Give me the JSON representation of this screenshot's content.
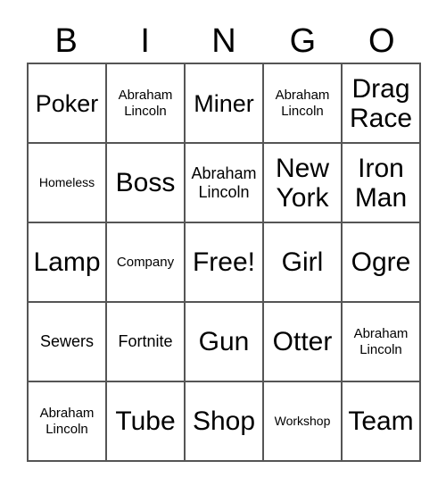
{
  "card": {
    "headers": [
      "B",
      "I",
      "N",
      "G",
      "O"
    ],
    "rows": [
      [
        {
          "text": "Poker",
          "size": "lg"
        },
        {
          "text": "Abraham\nLincoln",
          "size": "sm"
        },
        {
          "text": "Miner",
          "size": "lg"
        },
        {
          "text": "Abraham\nLincoln",
          "size": "sm"
        },
        {
          "text": "Drag\nRace",
          "size": "xl"
        }
      ],
      [
        {
          "text": "Homeless",
          "size": "xs"
        },
        {
          "text": "Boss",
          "size": "xl"
        },
        {
          "text": "Abraham\nLincoln",
          "size": "md"
        },
        {
          "text": "New\nYork",
          "size": "xl"
        },
        {
          "text": "Iron\nMan",
          "size": "xl"
        }
      ],
      [
        {
          "text": "Lamp",
          "size": "xl"
        },
        {
          "text": "Company",
          "size": "sm"
        },
        {
          "text": "Free!",
          "size": "xl"
        },
        {
          "text": "Girl",
          "size": "xl"
        },
        {
          "text": "Ogre",
          "size": "xl"
        }
      ],
      [
        {
          "text": "Sewers",
          "size": "md"
        },
        {
          "text": "Fortnite",
          "size": "md"
        },
        {
          "text": "Gun",
          "size": "xl"
        },
        {
          "text": "Otter",
          "size": "xl"
        },
        {
          "text": "Abraham\nLincoln",
          "size": "sm"
        }
      ],
      [
        {
          "text": "Abraham\nLincoln",
          "size": "sm"
        },
        {
          "text": "Tube",
          "size": "xl"
        },
        {
          "text": "Shop",
          "size": "xl"
        },
        {
          "text": "Workshop",
          "size": "xs"
        },
        {
          "text": "Team",
          "size": "xl"
        }
      ]
    ],
    "free_space_text": "Free!",
    "colors": {
      "grid_line": "#555555",
      "text": "#000000",
      "background": "#ffffff"
    }
  }
}
